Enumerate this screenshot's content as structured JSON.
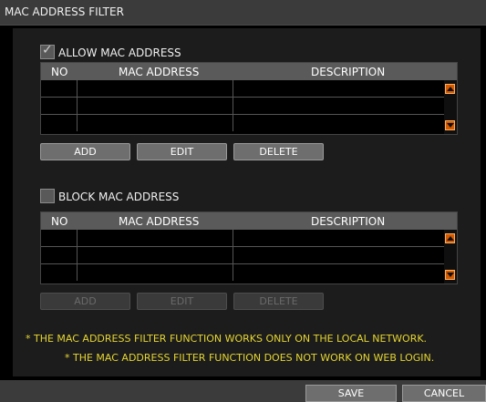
{
  "window": {
    "title": "MAC ADDRESS FILTER"
  },
  "allow": {
    "checkbox_label": "ALLOW MAC ADDRESS",
    "checked": true,
    "columns": [
      "NO",
      "MAC ADDRESS",
      "DESCRIPTION"
    ],
    "rows": [
      [
        "",
        "",
        ""
      ],
      [
        "",
        "",
        ""
      ],
      [
        "",
        "",
        ""
      ]
    ],
    "buttons": {
      "add": "ADD",
      "edit": "EDIT",
      "delete": "DELETE"
    },
    "buttons_enabled": true
  },
  "block": {
    "checkbox_label": "BLOCK MAC ADDRESS",
    "checked": false,
    "columns": [
      "NO",
      "MAC ADDRESS",
      "DESCRIPTION"
    ],
    "rows": [
      [
        "",
        "",
        ""
      ],
      [
        "",
        "",
        ""
      ],
      [
        "",
        "",
        ""
      ]
    ],
    "buttons": {
      "add": "ADD",
      "edit": "EDIT",
      "delete": "DELETE"
    },
    "buttons_enabled": false
  },
  "notes": [
    "* THE MAC ADDRESS FILTER FUNCTION WORKS ONLY ON THE LOCAL NETWORK.",
    "* THE MAC ADDRESS FILTER FUNCTION DOES NOT WORK ON WEB LOGIN."
  ],
  "footer": {
    "save": "SAVE",
    "cancel": "CANCEL"
  },
  "colors": {
    "scroll_button": "#d65a00",
    "note_text": "#e6d630"
  },
  "icons": {
    "checkmark": "checkmark-icon",
    "scroll_up": "scroll-up-arrow-icon",
    "scroll_down": "scroll-down-arrow-icon"
  }
}
